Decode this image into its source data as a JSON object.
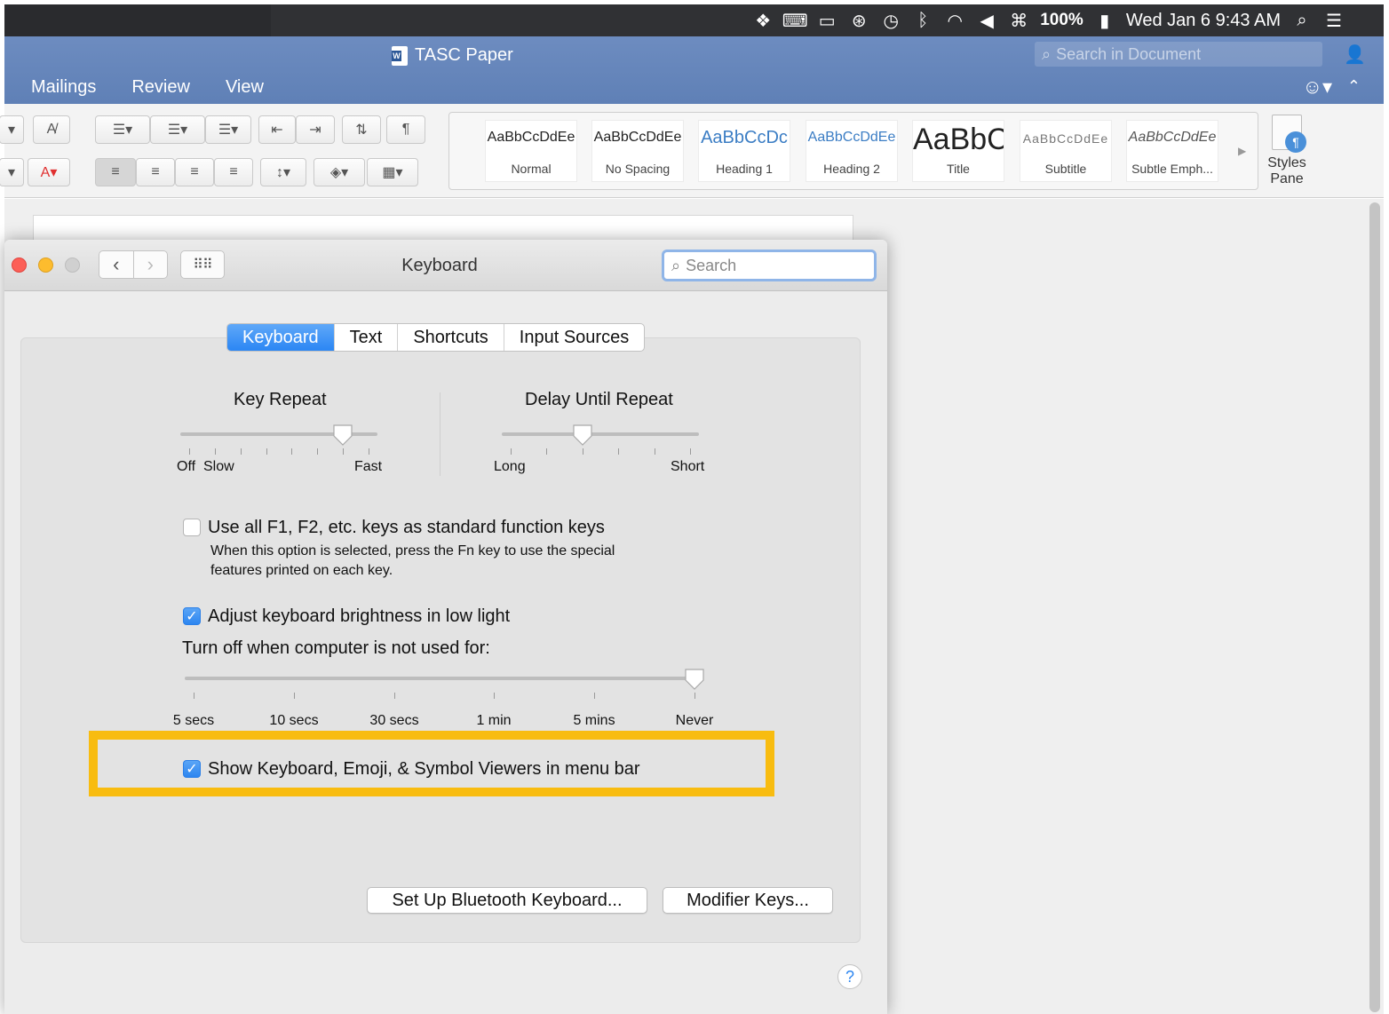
{
  "menubar": {
    "battery_percent": "100%",
    "datetime": "Wed Jan 6  9:43 AM",
    "icons": [
      "dropbox-icon",
      "keyboard-viewer-icon",
      "airplay-icon",
      "accessibility-icon",
      "time-machine-icon",
      "bluetooth-icon",
      "wifi-icon",
      "volume-icon",
      "input-menu-icon",
      "battery-icon",
      "spotlight-icon",
      "notification-center-icon"
    ]
  },
  "word": {
    "doc_title": "TASC Paper",
    "search_placeholder": "Search in Document",
    "tabs": [
      "Mailings",
      "Review",
      "View"
    ],
    "styles": [
      {
        "sample": "AaBbCcDdEe",
        "name": "Normal"
      },
      {
        "sample": "AaBbCcDdEe",
        "name": "No Spacing"
      },
      {
        "sample": "AaBbCcDc",
        "name": "Heading 1"
      },
      {
        "sample": "AaBbCcDdEe",
        "name": "Heading 2"
      },
      {
        "sample": "AaBbC",
        "name": "Title"
      },
      {
        "sample": "AaBbCcDdEe",
        "name": "Subtitle"
      },
      {
        "sample": "AaBbCcDdEe",
        "name": "Subtle Emph..."
      }
    ],
    "styles_pane_line1": "Styles",
    "styles_pane_line2": "Pane"
  },
  "prefs": {
    "title": "Keyboard",
    "search_placeholder": "Search",
    "tabs": [
      "Keyboard",
      "Text",
      "Shortcuts",
      "Input Sources"
    ],
    "selected_tab": "Keyboard",
    "key_repeat": {
      "title": "Key Repeat",
      "label_left": "Off",
      "label_slow": "Slow",
      "label_right": "Fast",
      "ticks": 8,
      "value_step": 6
    },
    "delay_until_repeat": {
      "title": "Delay Until Repeat",
      "label_left": "Long",
      "label_right": "Short",
      "ticks": 6,
      "value_step": 2
    },
    "fn_keys": {
      "label": "Use all F1, F2, etc. keys as standard function keys",
      "checked": false,
      "note_line1": "When this option is selected, press the Fn key to use the special",
      "note_line2": "features printed on each key."
    },
    "brightness": {
      "label": "Adjust keyboard brightness in low light",
      "checked": true
    },
    "turn_off": {
      "label": "Turn off when computer is not used for:",
      "options": [
        "5 secs",
        "10 secs",
        "30 secs",
        "1 min",
        "5 mins",
        "Never"
      ],
      "selected": "Never"
    },
    "show_viewers": {
      "label": "Show Keyboard, Emoji, & Symbol Viewers in menu bar",
      "checked": true
    },
    "bluetooth_button": "Set Up Bluetooth Keyboard...",
    "modifier_button": "Modifier Keys...",
    "help": "?"
  },
  "colors": {
    "highlight": "#f8bc10",
    "accent": "#2d86f0",
    "word_blue": "#6b8bbf"
  }
}
